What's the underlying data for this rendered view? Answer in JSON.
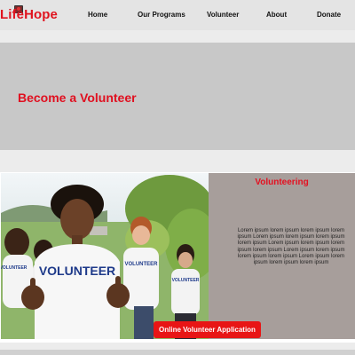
{
  "brand": {
    "name": "LifeHope",
    "logo_icon": "heart-hands-icon",
    "color": "#e0141f"
  },
  "nav": {
    "home": "Home",
    "programs": "Our Programs",
    "volunteer": "Volunteer",
    "about": "About",
    "donate": "Donate"
  },
  "hero": {
    "title": "Become a Volunteer"
  },
  "volunteering": {
    "title": "Volunteering",
    "text": "Lorem ipsum lorem ipsum lorem ipsum lorem ipsum Lorem ipsum lorem ipsum lorem ipsum lorem ipsum Lorem ipsum lorem ipsum lorem ipsum lorem ipsum Lorem ipsum lorem ipsum lorem ipsum lorem ipsum Lorem ipsum lorem ipsum lorem ipsum lorem ipsum",
    "photo_shirt_text": "VOLUNTEER",
    "apply_label": "Online Volunteer Application"
  },
  "colors": {
    "accent": "#e01020",
    "hero_bg": "#c8c8c8",
    "panel_bg": "#a79e9b",
    "button_bg": "#e81515"
  }
}
